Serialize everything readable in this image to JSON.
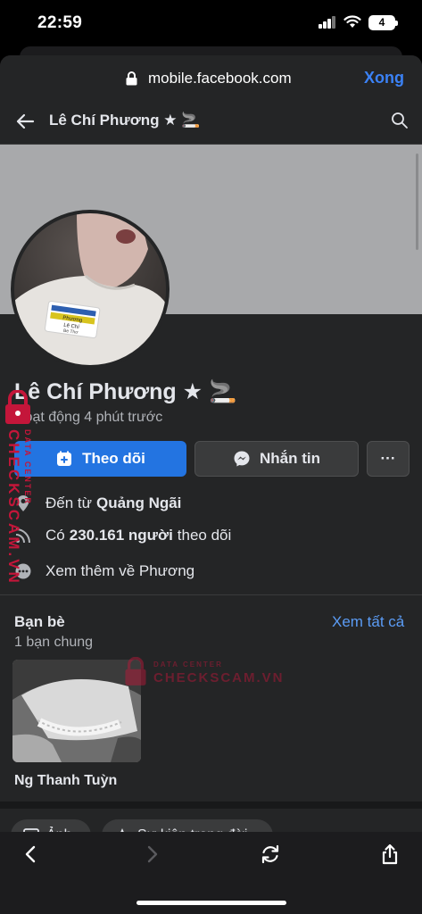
{
  "status_bar": {
    "time": "22:59",
    "battery": "4"
  },
  "browser": {
    "url": "mobile.facebook.com",
    "done_label": "Xong"
  },
  "header": {
    "title": "Lê Chí Phương ★ 🚬"
  },
  "profile": {
    "name": "Lê Chí Phương ★ 🚬",
    "activity": "Hoạt động 4 phút trước",
    "avatar_shirt_text": [
      "Phương",
      "Lê Chí",
      "Be Thơ"
    ]
  },
  "actions": {
    "follow": "Theo dõi",
    "message": "Nhắn tin",
    "more": "···"
  },
  "details": {
    "from_prefix": "Đến từ",
    "from_place": "Quảng Ngãi",
    "followers_prefix": "Có",
    "followers_count": "230.161 người",
    "followers_suffix": "theo dõi",
    "see_more": "Xem thêm về Phương"
  },
  "friends": {
    "title": "Bạn bè",
    "see_all": "Xem tất cả",
    "mutual": "1 bạn chung",
    "items": [
      {
        "name": "Ng Thanh Tuỳn"
      }
    ]
  },
  "chips": [
    {
      "label": "Ảnh"
    },
    {
      "label": "Sự kiện trong đời"
    }
  ],
  "watermark": {
    "line1": "DATA CENTER",
    "line2": "CHECKSCAM.VN"
  },
  "colors": {
    "accent": "#2374e1",
    "link": "#5b9cf5",
    "background": "#242526",
    "watermark": "#c4163a"
  },
  "icons": {
    "lock": "lock-icon",
    "back": "arrow-left-icon",
    "search": "search-icon",
    "follow": "follow-icon",
    "messenger": "messenger-icon",
    "location": "location-pin-icon",
    "followers": "rss-icon",
    "more": "more-dots-icon",
    "nav_back": "chevron-left-icon",
    "nav_forward": "chevron-right-icon",
    "reload": "reload-icon",
    "share": "share-icon"
  }
}
